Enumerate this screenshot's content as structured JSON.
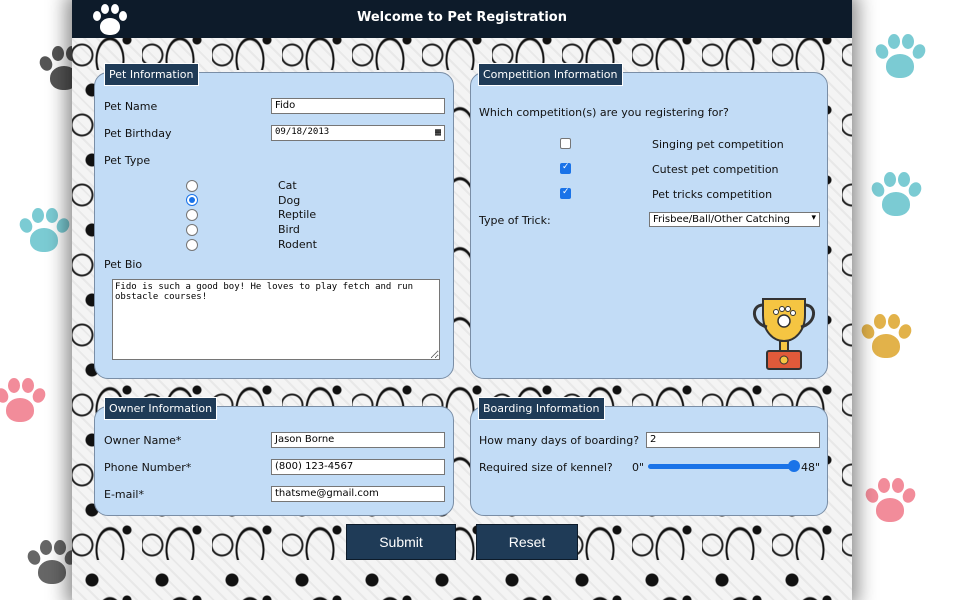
{
  "header": {
    "title": "Welcome to Pet Registration",
    "logo_icon": "paw-icon"
  },
  "colors": {
    "header_bg": "#0d1b2a",
    "panel_bg": "#c2dcf6",
    "legend_bg": "#1f3b57",
    "accent": "#1a73e8"
  },
  "pet_info": {
    "legend": "Pet Information",
    "name_label": "Pet Name",
    "name_value": "Fido",
    "birthday_label": "Pet Birthday",
    "birthday_value": "09/18/2013",
    "type_label": "Pet Type",
    "types": [
      {
        "label": "Cat",
        "selected": false
      },
      {
        "label": "Dog",
        "selected": true
      },
      {
        "label": "Reptile",
        "selected": false
      },
      {
        "label": "Bird",
        "selected": false
      },
      {
        "label": "Rodent",
        "selected": false
      }
    ],
    "bio_label": "Pet Bio",
    "bio_value": "Fido is such a good boy! He loves to play fetch and run obstacle courses!"
  },
  "competition": {
    "legend": "Competition Information",
    "question": "Which competition(s) are you registering for?",
    "options": [
      {
        "label": "Singing pet competition",
        "checked": false
      },
      {
        "label": "Cutest pet competition",
        "checked": true
      },
      {
        "label": "Pet tricks competition",
        "checked": true
      }
    ],
    "trick_label": "Type of Trick:",
    "trick_value": "Frisbee/Ball/Other Catching",
    "trophy_icon": "trophy-icon"
  },
  "owner": {
    "legend": "Owner Information",
    "name_label": "Owner Name*",
    "name_value": "Jason Borne",
    "phone_label": "Phone Number*",
    "phone_value": "(800) 123-4567",
    "email_label": "E-mail*",
    "email_value": "thatsme@gmail.com"
  },
  "boarding": {
    "legend": "Boarding Information",
    "days_label": "How many days of boarding?",
    "days_value": "2",
    "kennel_label": "Required size of kennel?",
    "kennel_min": "0\"",
    "kennel_max": "48\"",
    "kennel_level": 1.0
  },
  "actions": {
    "submit_label": "Submit",
    "reset_label": "Reset"
  }
}
